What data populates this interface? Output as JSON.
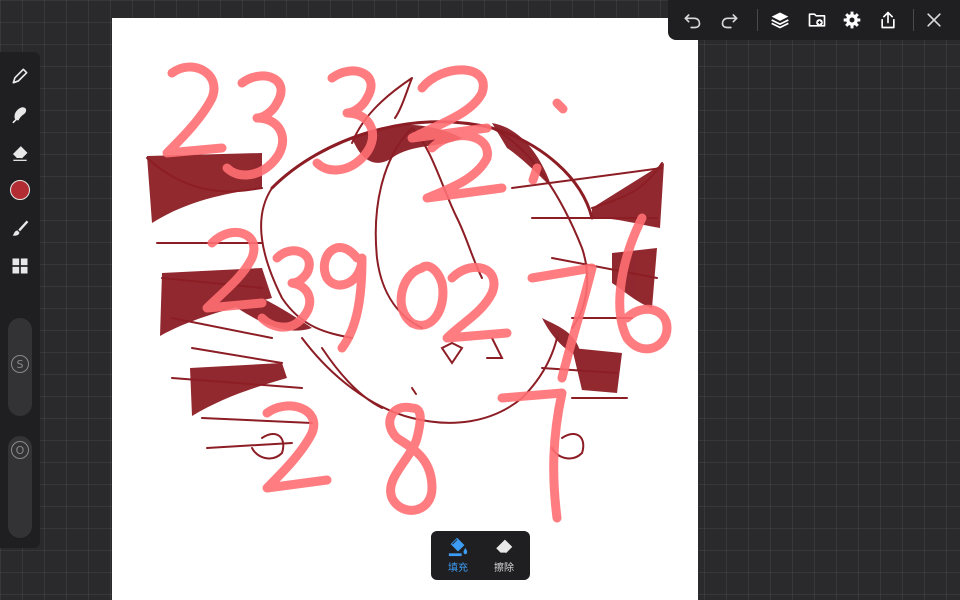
{
  "toolbar_left": {
    "tools": [
      {
        "name": "pen",
        "icon": "pen-icon"
      },
      {
        "name": "smudge",
        "icon": "smudge-icon"
      },
      {
        "name": "eraser",
        "icon": "eraser-icon"
      },
      {
        "name": "color",
        "icon": "color-swatch"
      },
      {
        "name": "brush-settings",
        "icon": "brush-icon"
      },
      {
        "name": "layout",
        "icon": "grid-icon"
      }
    ],
    "current_color": "#b22d33",
    "size_slider_label": "S",
    "opacity_slider_label": "O"
  },
  "toolbar_top": {
    "buttons": [
      "undo-icon",
      "redo-icon",
      "layers-icon",
      "import-icon",
      "gear-icon",
      "share-icon",
      "close-icon"
    ]
  },
  "fill_panel": {
    "fill_label": "填充",
    "erase_label": "擦除",
    "active": "fill",
    "active_color": "#3d9df5"
  },
  "canvas": {
    "background": "#ffffff",
    "handwritten_numbers": [
      "2332",
      "239",
      "0276",
      "287"
    ],
    "stroke_color_sketch": "#8c1d24",
    "stroke_color_numbers": "#ff6f73"
  }
}
